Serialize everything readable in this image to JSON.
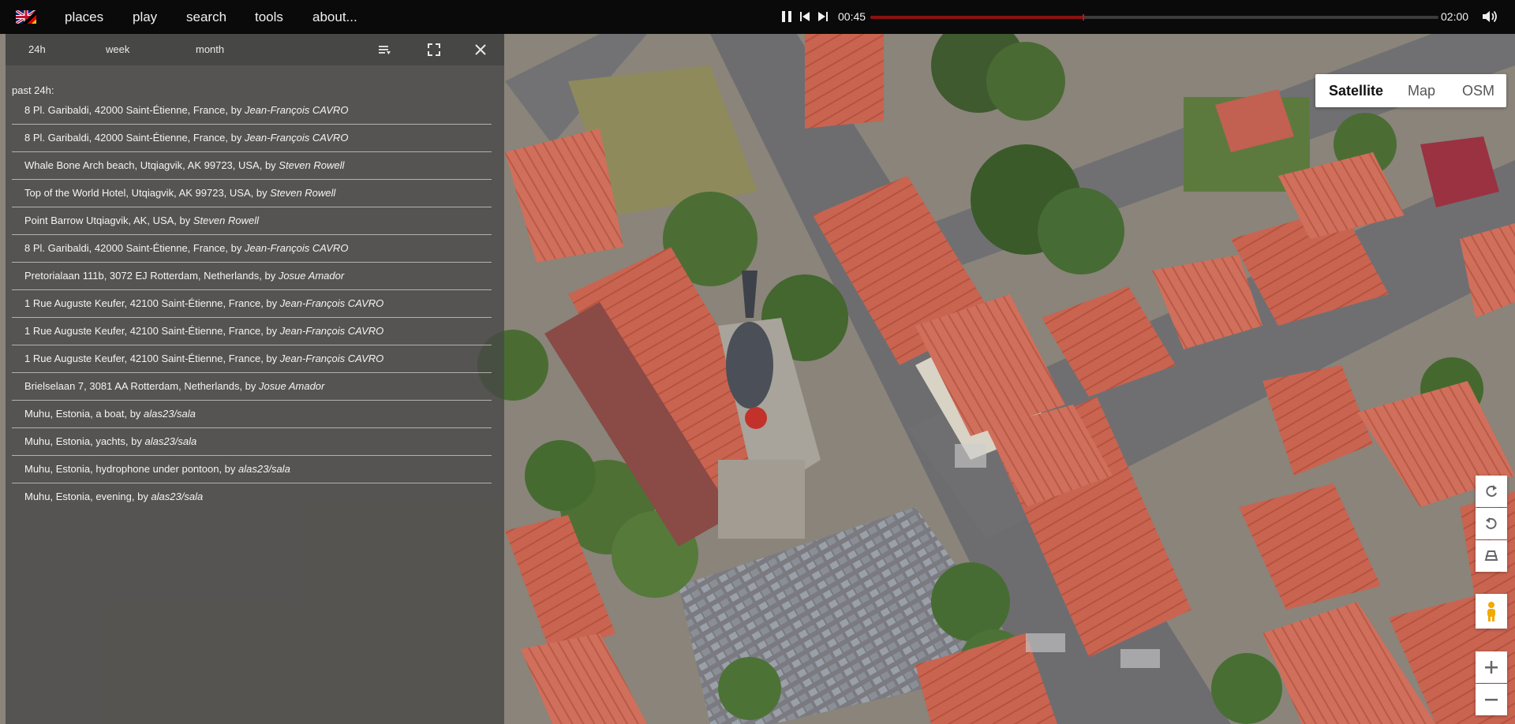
{
  "topbar": {
    "language_flag": "uk-german-flag-icon",
    "menu": [
      "places",
      "play",
      "search",
      "tools",
      "about..."
    ],
    "player": {
      "current_time": "00:45",
      "total_time": "02:00",
      "progress": 0.375,
      "progress_color": "#8a1212"
    }
  },
  "panel": {
    "tabs": [
      "24h",
      "week",
      "month"
    ],
    "section_label": "past 24h:",
    "items": [
      {
        "place": "8 Pl. Garibaldi, 42000 Saint-Étienne, France, by ",
        "author": "Jean-François CAVRO"
      },
      {
        "place": "8 Pl. Garibaldi, 42000 Saint-Étienne, France, by ",
        "author": "Jean-François CAVRO"
      },
      {
        "place": "Whale Bone Arch beach, Utqiagvik, AK 99723, USA, by ",
        "author": "Steven Rowell"
      },
      {
        "place": "Top of the World Hotel, Utqiagvik, AK 99723, USA, by ",
        "author": "Steven Rowell"
      },
      {
        "place": "Point Barrow Utqiagvik, AK, USA, by ",
        "author": "Steven Rowell"
      },
      {
        "place": "8 Pl. Garibaldi, 42000 Saint-Étienne, France, by ",
        "author": "Jean-François CAVRO"
      },
      {
        "place": "Pretorialaan 111b, 3072 EJ Rotterdam, Netherlands, by ",
        "author": "Josue Amador"
      },
      {
        "place": "1 Rue Auguste Keufer, 42100 Saint-Étienne, France, by ",
        "author": "Jean-François CAVRO"
      },
      {
        "place": "1 Rue Auguste Keufer, 42100 Saint-Étienne, France, by ",
        "author": "Jean-François CAVRO"
      },
      {
        "place": "1 Rue Auguste Keufer, 42100 Saint-Étienne, France, by ",
        "author": "Jean-François CAVRO"
      },
      {
        "place": "Brielselaan 7, 3081 AA Rotterdam, Netherlands, by ",
        "author": "Josue Amador"
      },
      {
        "place": "Muhu, Estonia, a boat, by ",
        "author": "alas23/sala"
      },
      {
        "place": "Muhu, Estonia, yachts, by ",
        "author": "alas23/sala"
      },
      {
        "place": "Muhu, Estonia, hydrophone under pontoon, by ",
        "author": "alas23/sala"
      },
      {
        "place": "Muhu, Estonia, evening, by ",
        "author": "alas23/sala"
      }
    ]
  },
  "map": {
    "map_types": [
      "Satellite",
      "Map",
      "OSM"
    ],
    "active_map_type": "Satellite",
    "controls": [
      "rotate-clockwise-icon",
      "rotate-counterclockwise-icon",
      "tilt-view-icon",
      "pegman-icon",
      "zoom-in-icon",
      "zoom-out-icon"
    ]
  }
}
